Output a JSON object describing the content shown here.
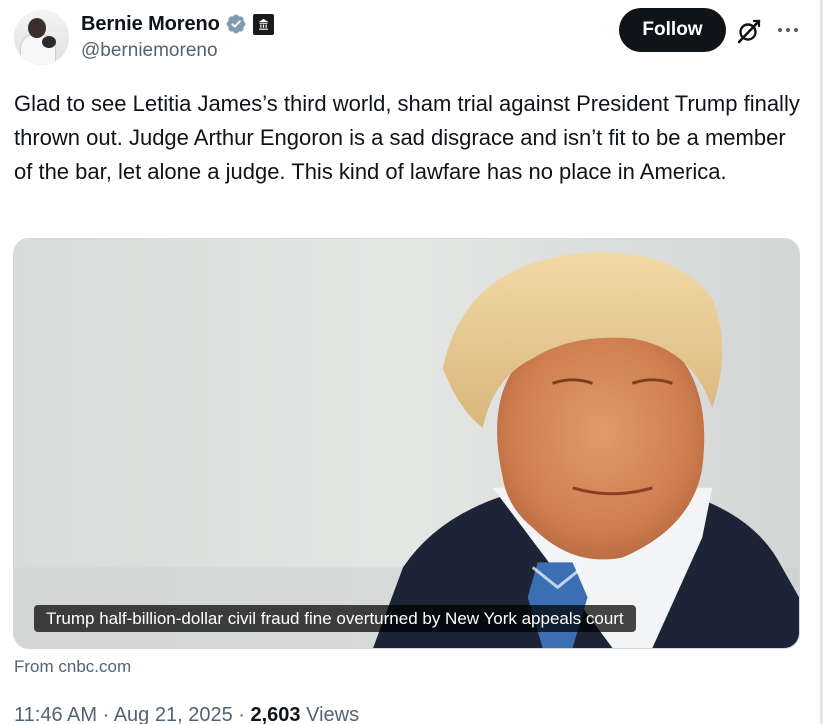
{
  "author": {
    "display_name": "Bernie Moreno",
    "handle": "@berniemoreno",
    "verified_color": "#829aab"
  },
  "actions": {
    "follow_label": "Follow",
    "grok_icon": "grok-icon",
    "more_icon": "more-icon"
  },
  "tweet": {
    "text": "Glad to see Letitia James’s third world, sham trial against President Trump finally thrown out. Judge Arthur Engoron is a sad disgrace and isn’t fit to be a member of the bar, let alone a judge. This kind of lawfare has no place in America."
  },
  "card": {
    "caption": "Trump half-billion-dollar civil fraud fine overturned by New York appeals court",
    "source": "From cnbc.com"
  },
  "meta": {
    "time": "11:46 AM",
    "separator": " · ",
    "date": "Aug 21, 2025",
    "views_count": "2,603",
    "views_label": "Views"
  },
  "colors": {
    "follow_bg": "#0f1419",
    "secondary_text": "#536471"
  }
}
